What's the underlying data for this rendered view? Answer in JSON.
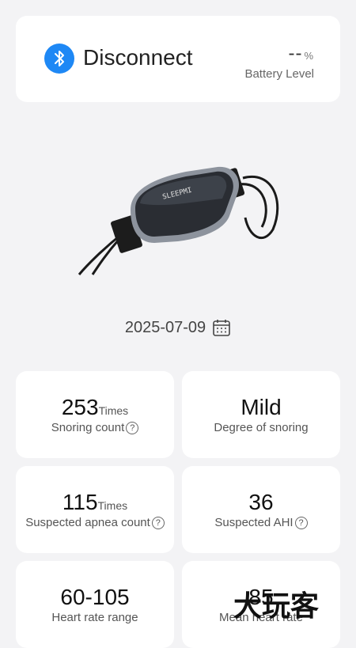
{
  "connection": {
    "status": "Disconnect",
    "icon": "bluetooth-icon"
  },
  "battery": {
    "value": "--",
    "unit": "%",
    "label": "Battery Level"
  },
  "date": {
    "value": "2025-07-09",
    "icon": "calendar-icon"
  },
  "stats": {
    "snoring_count": {
      "value": "253",
      "unit": "Times",
      "label": "Snoring count"
    },
    "snoring_degree": {
      "value": "Mild",
      "label": "Degree of snoring"
    },
    "apnea_count": {
      "value": "115",
      "unit": "Times",
      "label": "Suspected apnea count"
    },
    "ahi": {
      "value": "36",
      "label": "Suspected AHI"
    },
    "heart_rate_range": {
      "value": "60-105",
      "label": "Heart rate range"
    },
    "mean_heart_rate": {
      "value": "85",
      "label": "Mean heart rate"
    }
  },
  "watermark": "大玩客",
  "colors": {
    "accent": "#1e88f5",
    "background": "#f3f3f5",
    "card": "#ffffff"
  }
}
